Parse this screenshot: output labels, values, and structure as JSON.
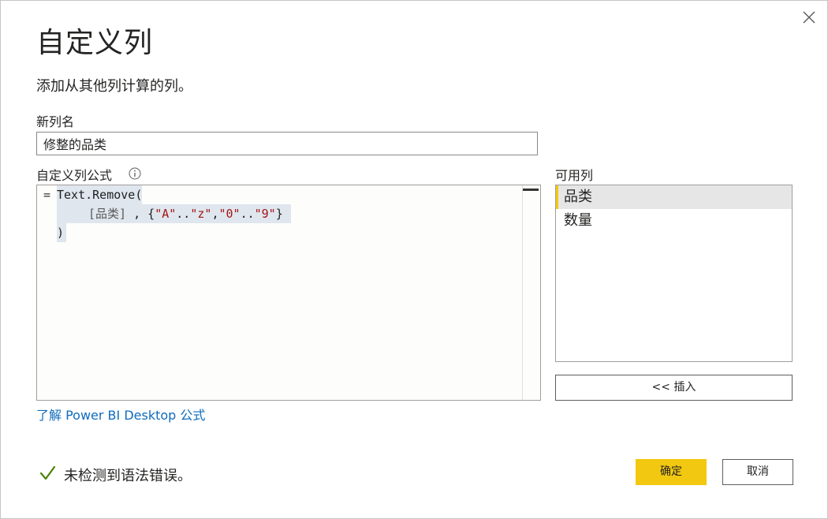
{
  "dialog": {
    "title": "自定义列",
    "subtitle": "添加从其他列计算的列。"
  },
  "new_column": {
    "label": "新列名",
    "value": "修整的品类"
  },
  "formula": {
    "label": "自定义列公式",
    "prefix": "=",
    "line1": "Text.Remove(",
    "line2_col": "[品类]",
    "line2_sep": " , {",
    "tokens": [
      "\"A\"",
      "..",
      "\"z\"",
      ",",
      "\"0\"",
      "..",
      "\"9\"",
      "}"
    ],
    "line3": ")"
  },
  "available_columns": {
    "label": "可用列",
    "items": [
      {
        "label": "品类",
        "selected": true
      },
      {
        "label": "数量",
        "selected": false
      }
    ],
    "insert_label": "<< 插入"
  },
  "learn_link": "了解 Power BI Desktop 公式",
  "status": {
    "text": "未检测到语法错误。",
    "icon": "check-icon"
  },
  "buttons": {
    "ok": "确定",
    "cancel": "取消"
  },
  "colors": {
    "accent": "#f2c811",
    "link": "#0f6cbd",
    "success": "#498205",
    "string": "#a31515"
  }
}
